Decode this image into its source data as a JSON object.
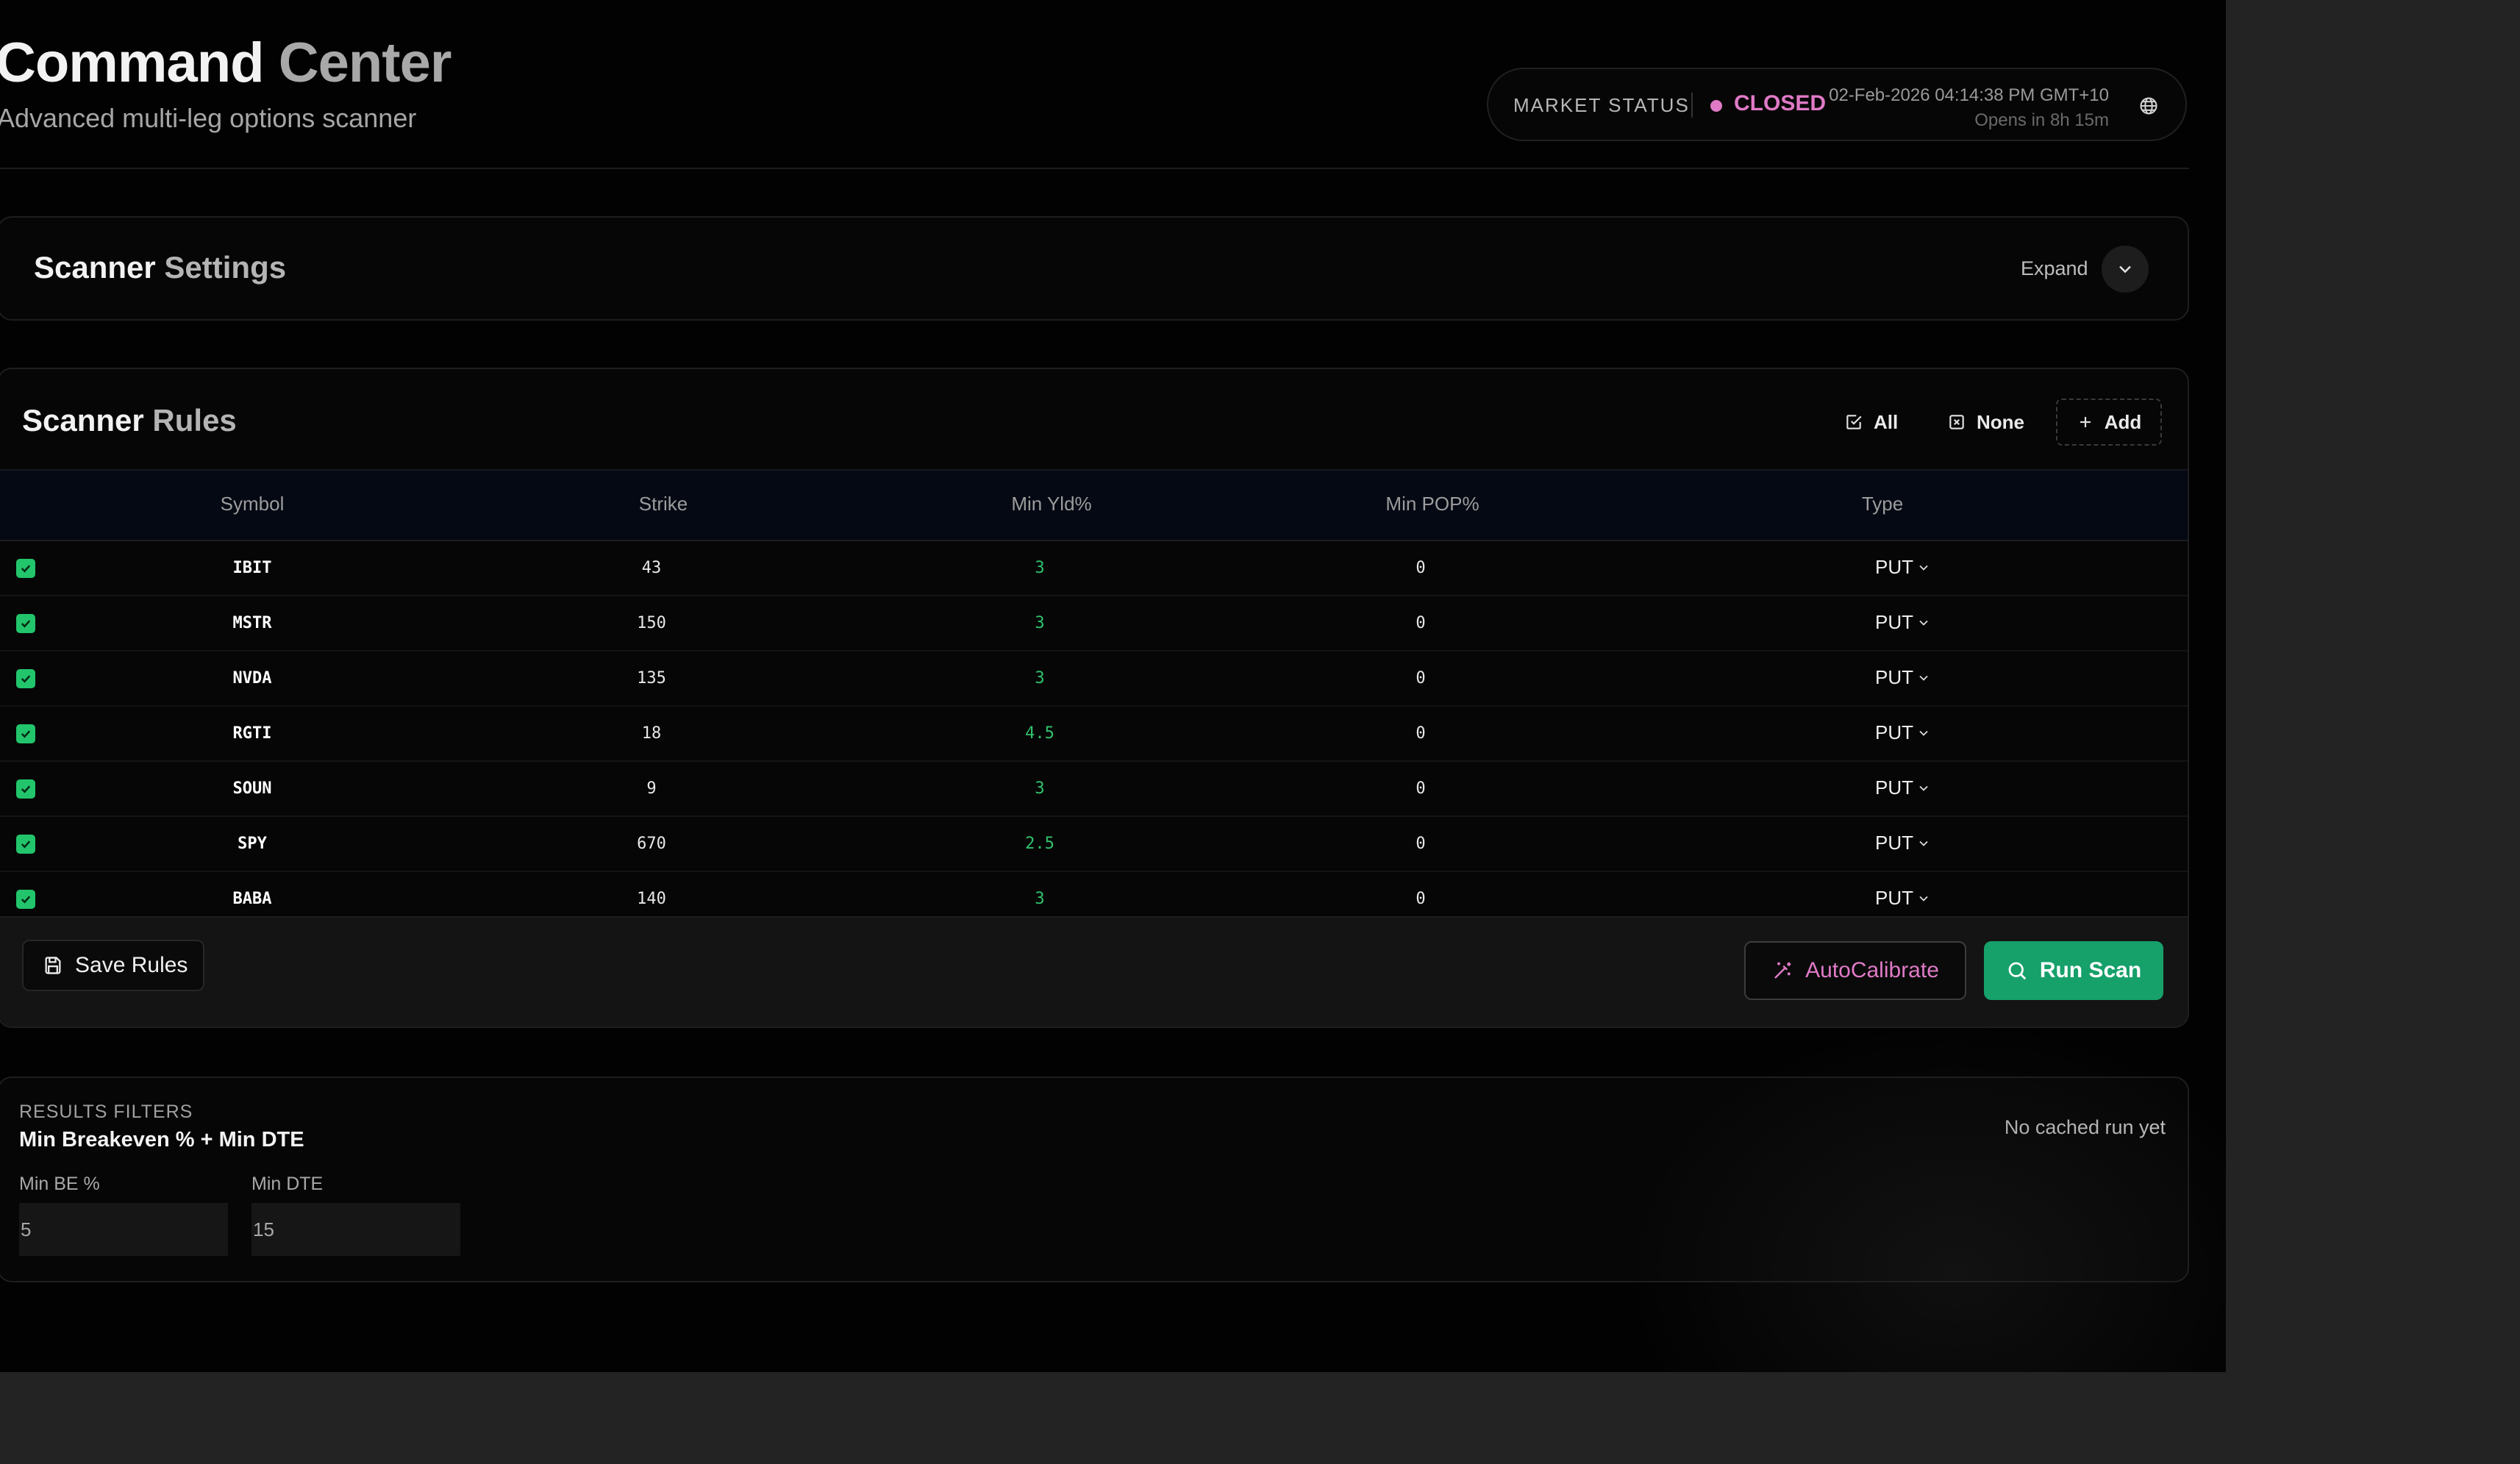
{
  "header": {
    "title_primary": "Command",
    "title_secondary": "Center",
    "subtitle": "Advanced multi-leg options scanner",
    "market_status": {
      "label": "MARKET STATUS",
      "state": "CLOSED",
      "state_color": "#e07ac6",
      "datetime": "02-Feb-2026 04:14:38 PM GMT+10",
      "opens_in": "Opens in 8h 15m",
      "icon": "globe-icon"
    }
  },
  "settings": {
    "title_primary": "Scanner",
    "title_secondary": "Settings",
    "expand_label": "Expand",
    "icon": "chevron-down-icon"
  },
  "rules": {
    "title_primary": "Scanner",
    "title_secondary": "Rules",
    "toolbar": {
      "all_label": "All",
      "none_label": "None",
      "add_label": "Add"
    },
    "columns": [
      "Symbol",
      "Strike",
      "Min Yld%",
      "Min POP%",
      "Type"
    ],
    "rows": [
      {
        "checked": true,
        "symbol": "IBIT",
        "strike": "43",
        "min_yld": "3",
        "min_pop": "0",
        "type": "PUT"
      },
      {
        "checked": true,
        "symbol": "MSTR",
        "strike": "150",
        "min_yld": "3",
        "min_pop": "0",
        "type": "PUT"
      },
      {
        "checked": true,
        "symbol": "NVDA",
        "strike": "135",
        "min_yld": "3",
        "min_pop": "0",
        "type": "PUT"
      },
      {
        "checked": true,
        "symbol": "RGTI",
        "strike": "18",
        "min_yld": "4.5",
        "min_pop": "0",
        "type": "PUT"
      },
      {
        "checked": true,
        "symbol": "SOUN",
        "strike": "9",
        "min_yld": "3",
        "min_pop": "0",
        "type": "PUT"
      },
      {
        "checked": true,
        "symbol": "SPY",
        "strike": "670",
        "min_yld": "2.5",
        "min_pop": "0",
        "type": "PUT"
      },
      {
        "checked": true,
        "symbol": "BABA",
        "strike": "140",
        "min_yld": "3",
        "min_pop": "0",
        "type": "PUT"
      }
    ],
    "footer": {
      "save_label": "Save Rules",
      "autocalibrate_label": "AutoCalibrate",
      "run_scan_label": "Run Scan"
    }
  },
  "filters": {
    "section_label": "RESULTS FILTERS",
    "title": "Min Breakeven % + Min DTE",
    "cache_status": "No cached run yet",
    "min_be_label": "Min BE %",
    "min_be_value": "5",
    "min_dte_label": "Min DTE",
    "min_dte_value": "15"
  },
  "colors": {
    "accent_green": "#16a06a",
    "yield_green": "#30c26c",
    "checkbox_green": "#22c56b",
    "closed_pink": "#e07ac6"
  }
}
